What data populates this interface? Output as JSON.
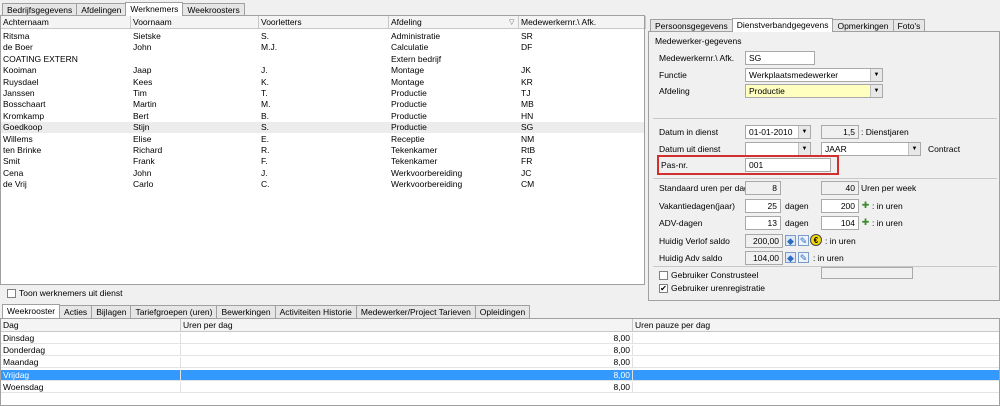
{
  "top_tabs": [
    "Bedrijfsgegevens",
    "Afdelingen",
    "Werknemers",
    "Weekroosters"
  ],
  "top_active": 2,
  "employees": {
    "columns": [
      "Achternaam",
      "Voornaam",
      "Voorletters",
      "Afdeling",
      "Medewerkernr.\\ Afk."
    ],
    "rows": [
      [
        "Ritsma",
        "Sietske",
        "S.",
        "Administratie",
        "SR"
      ],
      [
        "de Boer",
        "John",
        "M.J.",
        "Calculatie",
        "DF"
      ],
      [
        "COATING EXTERN",
        "",
        "",
        "Extern bedrijf",
        ""
      ],
      [
        "Kooiman",
        "Jaap",
        "J.",
        "Montage",
        "JK"
      ],
      [
        "Ruysdael",
        "Kees",
        "K.",
        "Montage",
        "KR"
      ],
      [
        "Janssen",
        "Tim",
        "T.",
        "Productie",
        "TJ"
      ],
      [
        "Bosschaart",
        "Martin",
        "M.",
        "Productie",
        "MB"
      ],
      [
        "Kromkamp",
        "Bert",
        "B.",
        "Productie",
        "HN"
      ],
      [
        "Goedkoop",
        "Stijn",
        "S.",
        "Productie",
        "SG"
      ],
      [
        "Willems",
        "Elise",
        "E.",
        "Receptie",
        "NM"
      ],
      [
        "ten Brinke",
        "Richard",
        "R.",
        "Tekenkamer",
        "RtB"
      ],
      [
        "Smit",
        "Frank",
        "F.",
        "Tekenkamer",
        "FR"
      ],
      [
        "Cena",
        "John",
        "J.",
        "Werkvoorbereiding",
        "JC"
      ],
      [
        "de Vrij",
        "Carlo",
        "C.",
        "Werkvoorbereiding",
        "CM"
      ]
    ],
    "selected_row": 8
  },
  "toon_label": "Toon werknemers uit dienst",
  "right_tabs": [
    "Persoonsgegevens",
    "Dienstverbandgegevens",
    "Opmerkingen",
    "Foto's"
  ],
  "right_active": 1,
  "form": {
    "group_title": "Medewerker-gegevens",
    "mnr_label": "Medewerkernr.\\ Afk.",
    "mnr_value": "SG",
    "functie_label": "Functie",
    "functie_value": "Werkplaatsmedewerker",
    "afdeling_label": "Afdeling",
    "afdeling_value": "Productie",
    "datum_in_label": "Datum in dienst",
    "datum_in_value": "01-01-2010",
    "dienstjaren_value": "1,5",
    "dienstjaren_label": ": Dienstjaren",
    "datum_uit_label": "Datum uit dienst",
    "datum_uit_value": "",
    "contract_value": "JAAR",
    "contract_label": "Contract",
    "pasnr_label": "Pas-nr.",
    "pasnr_value": "001",
    "std_uren_label": "Standaard uren per dag",
    "std_uren_value": "8",
    "uren_week_value": "40",
    "uren_week_label": "Uren per week",
    "vakantie_label": "Vakantiedagen(jaar)",
    "vakantie_value": "25",
    "dagen1": "dagen",
    "vakantie_uren": "200",
    "in_uren1": ": in uren",
    "adv_label": "ADV-dagen",
    "adv_value": "13",
    "dagen2": "dagen",
    "adv_uren": "104",
    "in_uren2": ": in uren",
    "verlof_label": "Huidig Verlof saldo",
    "verlof_value": "200,00",
    "in_uren3": ": in uren",
    "advsaldo_label": "Huidig Adv saldo",
    "advsaldo_value": "104,00",
    "in_uren4": ": in uren",
    "construsteel_label": "Gebruiker Construsteel",
    "urenreg_label": "Gebruiker urenregistratie"
  },
  "bottom_tabs": [
    "Weekrooster",
    "Acties",
    "Bijlagen",
    "Tariefgroepen (uren)",
    "Bewerkingen",
    "Activiteiten Historie",
    "Medewerker/Project Tarieven",
    "Opleidingen"
  ],
  "bottom_active": 0,
  "schedule": {
    "columns": [
      "Dag",
      "Uren per dag",
      "Uren pauze per dag"
    ],
    "rows": [
      [
        "Dinsdag",
        "8,00",
        ""
      ],
      [
        "Donderdag",
        "8,00",
        ""
      ],
      [
        "Maandag",
        "8,00",
        ""
      ],
      [
        "Vrijdag",
        "8,00",
        ""
      ],
      [
        "Woensdag",
        "8,00",
        ""
      ]
    ],
    "selected_row": 3
  },
  "colors": {
    "highlight": "#d32f2f",
    "selection": "#3399ff",
    "dropdown_yellow": "#ffffc0"
  }
}
